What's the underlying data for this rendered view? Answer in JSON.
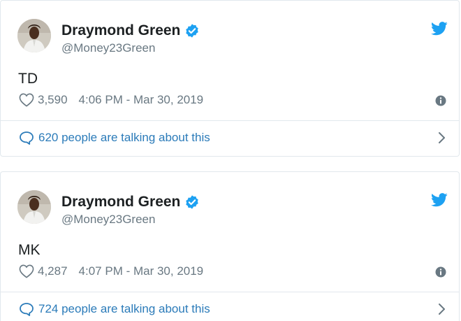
{
  "tweets": [
    {
      "author_name": "Draymond Green",
      "handle": "@Money23Green",
      "text": "TD",
      "likes": "3,590",
      "timestamp": "4:06 PM - Mar 30, 2019",
      "talking": "620 people are talking about this"
    },
    {
      "author_name": "Draymond Green",
      "handle": "@Money23Green",
      "text": "MK",
      "likes": "4,287",
      "timestamp": "4:07 PM - Mar 30, 2019",
      "talking": "724 people are talking about this"
    }
  ],
  "icons": {
    "verified": "verified-badge-icon",
    "brand": "twitter-bird-icon",
    "like": "heart-icon",
    "info": "info-icon",
    "conversation": "speech-bubble-icon",
    "expand": "chevron-right-icon"
  },
  "colors": {
    "twitter_blue": "#1da1f2",
    "link_blue": "#2b7bb9",
    "text_dark": "#1c2022",
    "text_gray": "#697882",
    "border": "#e1e8ed"
  }
}
